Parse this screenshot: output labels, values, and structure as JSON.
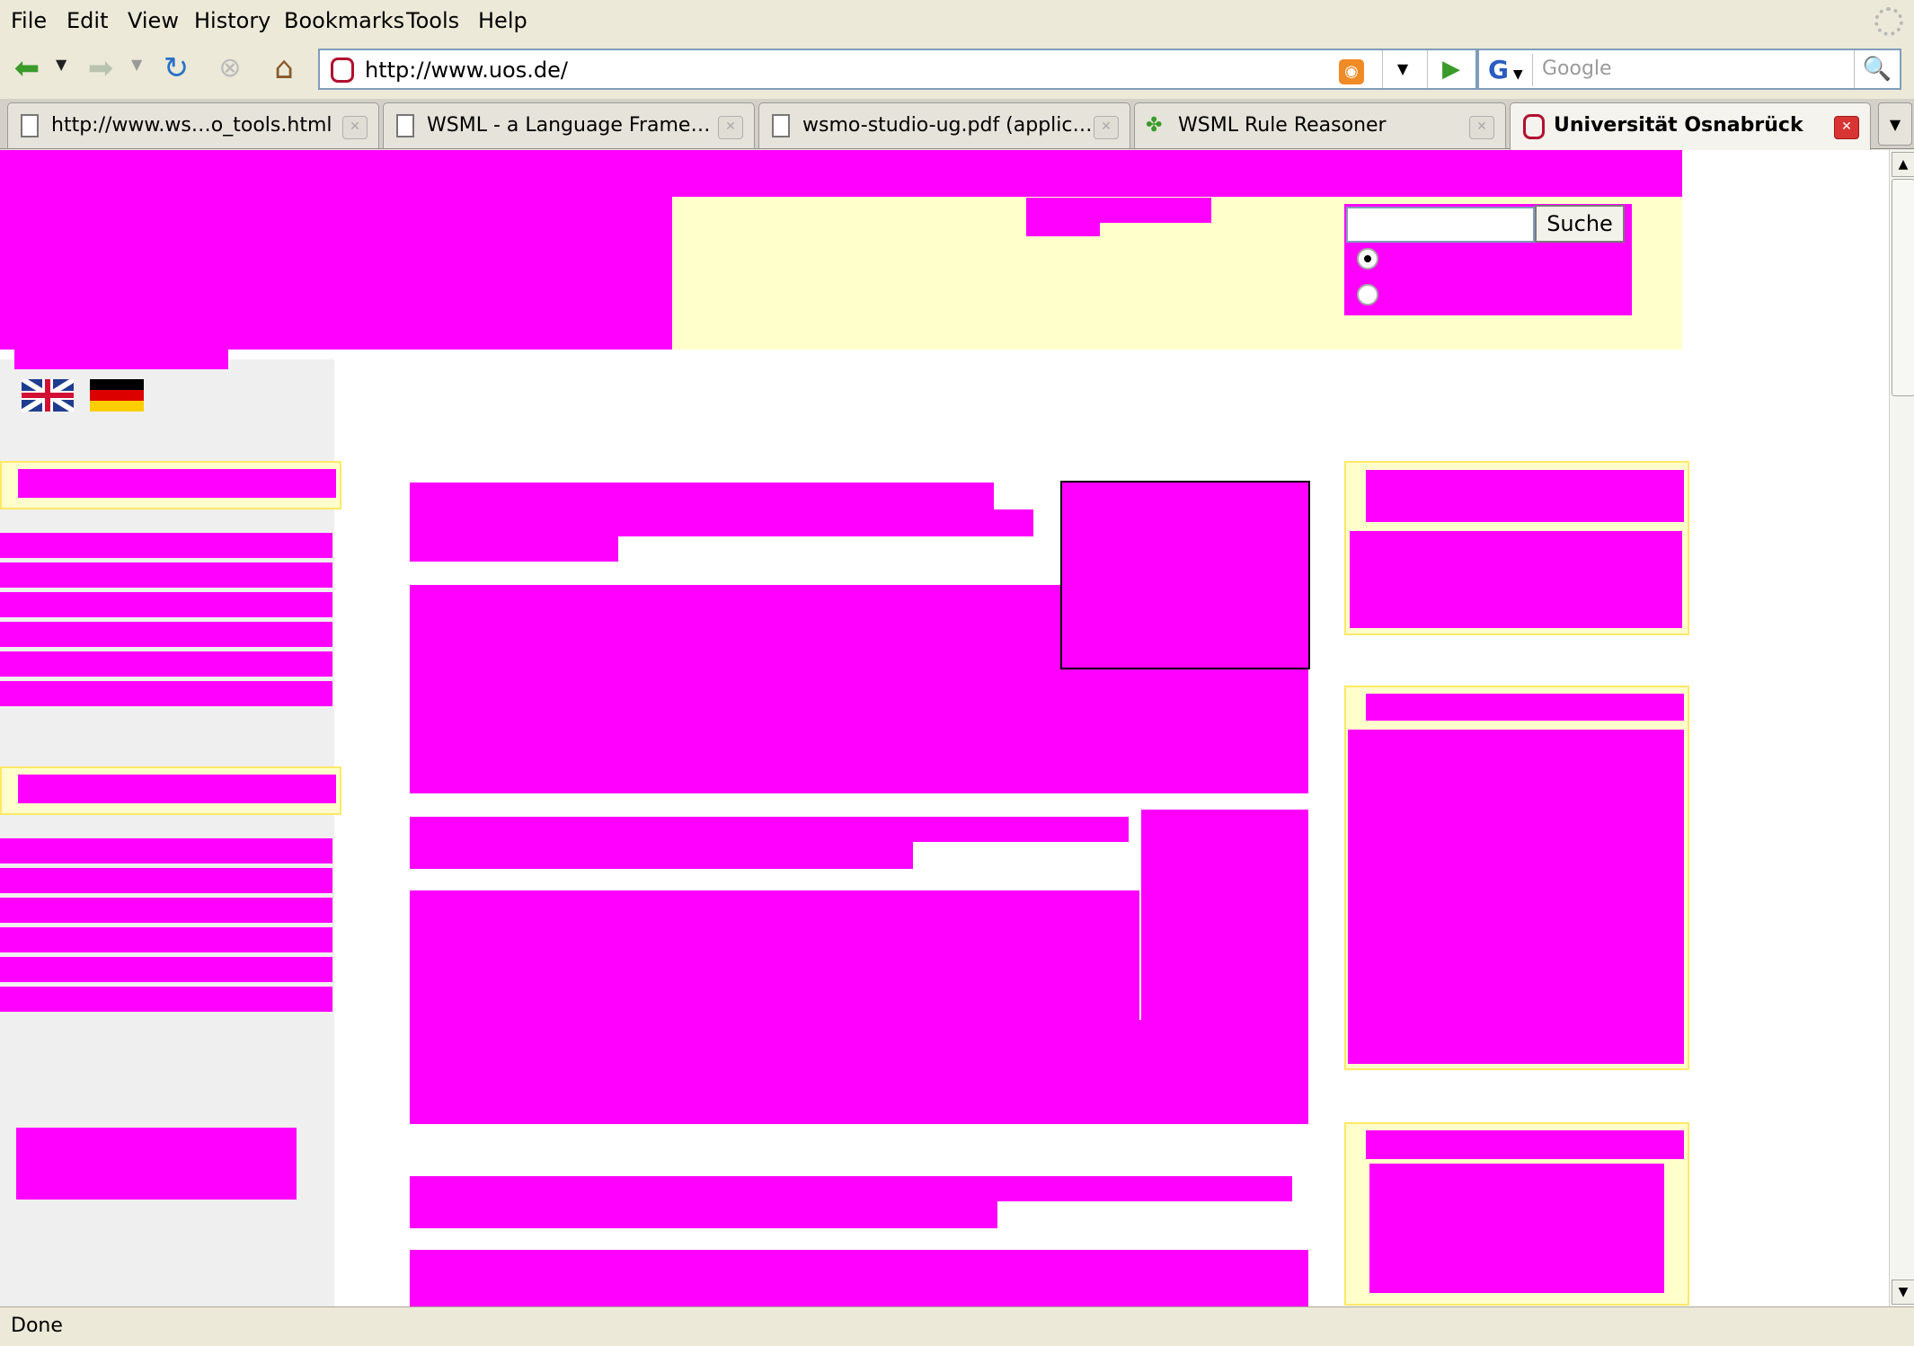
{
  "colors": {
    "redaction": "#ff00ff",
    "panel_fill": "#ffffcc",
    "panel_border": "#ffe866"
  },
  "menubar": {
    "items": [
      "File",
      "Edit",
      "View",
      "History",
      "Bookmarks",
      "Tools",
      "Help"
    ]
  },
  "navbar": {
    "url": "http://www.uos.de/",
    "search_placeholder": "Google",
    "search_engine_letter": "G"
  },
  "tabs": [
    {
      "label": "http://www.ws…o_tools.html",
      "icon": "document-icon",
      "active": false
    },
    {
      "label": "WSML - a Language Frame…",
      "icon": "document-icon",
      "active": false
    },
    {
      "label": "wsmo-studio-ug.pdf (applic…",
      "icon": "document-icon",
      "active": false
    },
    {
      "label": "WSML Rule Reasoner",
      "icon": "puzzle-icon",
      "active": false
    },
    {
      "label": "Universität Osnabrück",
      "icon": "university-seal-icon",
      "active": true
    }
  ],
  "page": {
    "search_button_label": "Suche",
    "search_value": ""
  },
  "status": {
    "text": "Done"
  }
}
